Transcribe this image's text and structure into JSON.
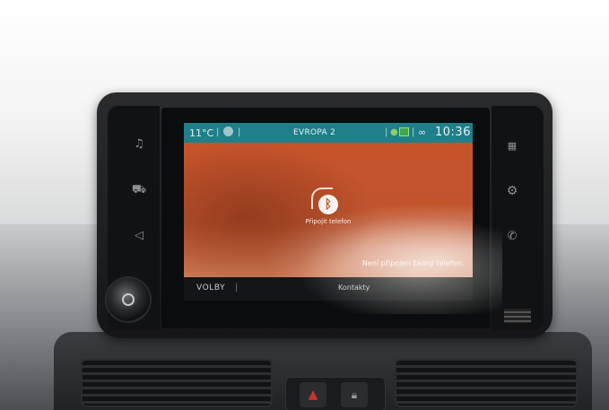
{
  "status_bar": {
    "temperature": "11°C",
    "separator": "|",
    "station": "EVROPA 2",
    "clock": "10:36",
    "icons": [
      "globe-icon",
      "gps-icon",
      "navigation-map-icon",
      "phone-link-icon"
    ],
    "accent_color": "#1f7f8a"
  },
  "main": {
    "bluetooth_label": "Připojit telefon",
    "bluetooth_icon": "bluetooth-icon",
    "notice": "Není připojen žádný telefon.",
    "background_color": "#c15a31"
  },
  "bottom_bar": {
    "options_label": "VOLBY",
    "divider": "|",
    "contacts_label": "Kontakty"
  },
  "hardware_buttons": {
    "left": [
      "music-icon",
      "car-icon",
      "navigation-icon"
    ],
    "right": [
      "apps-grid-icon",
      "settings-gear-icon",
      "phone-icon"
    ]
  }
}
